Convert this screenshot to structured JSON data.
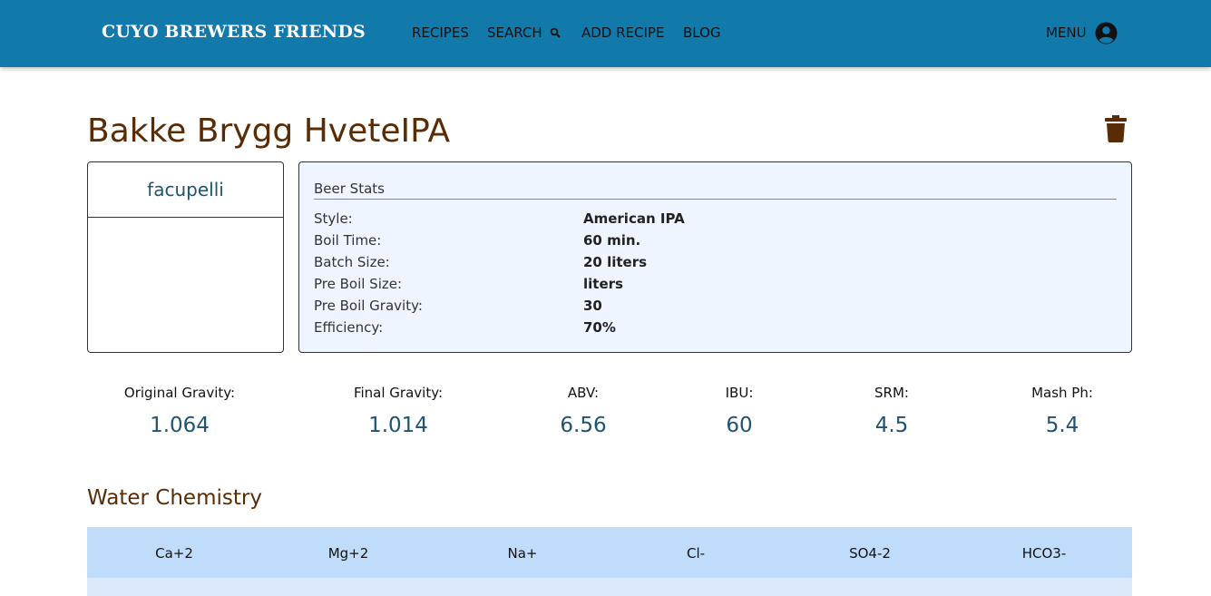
{
  "nav": {
    "brand": "CUYO BREWERS FRIENDS",
    "links": [
      "RECIPES",
      "SEARCH",
      "ADD RECIPE",
      "BLOG"
    ],
    "menu": "MENU",
    "search_icon": "magnifier-icon",
    "user_icon": "user-circle-icon"
  },
  "recipe": {
    "title": "Bakke Brygg HveteIPA",
    "delete_icon": "trash-icon",
    "author": "facupelli"
  },
  "beer_stats": {
    "heading": "Beer Stats",
    "rows": [
      {
        "label": "Style:",
        "value": "American IPA"
      },
      {
        "label": "Boil Time:",
        "value": "60 min."
      },
      {
        "label": "Batch Size:",
        "value": "20 liters"
      },
      {
        "label": "Pre Boil Size:",
        "value": "liters"
      },
      {
        "label": "Pre Boil Gravity:",
        "value": "30"
      },
      {
        "label": "Efficiency:",
        "value": "70%"
      }
    ]
  },
  "metrics": [
    {
      "label": "Original Gravity:",
      "value": "1.064"
    },
    {
      "label": "Final Gravity:",
      "value": "1.014"
    },
    {
      "label": "ABV:",
      "value": "6.56"
    },
    {
      "label": "IBU:",
      "value": "60"
    },
    {
      "label": "SRM:",
      "value": "4.5"
    },
    {
      "label": "Mash Ph:",
      "value": "5.4"
    }
  ],
  "water": {
    "title": "Water Chemistry",
    "columns": [
      "Ca+2",
      "Mg+2",
      "Na+",
      "Cl-",
      "SO4-2",
      "HCO3-"
    ]
  },
  "colors": {
    "navbar": "#117aab",
    "title_brown": "#5a2c06",
    "value_blue": "#1d5472",
    "stats_bg": "#eef5fe",
    "table_header": "#bfdcfb",
    "rule_teal": "#3aaa96"
  }
}
